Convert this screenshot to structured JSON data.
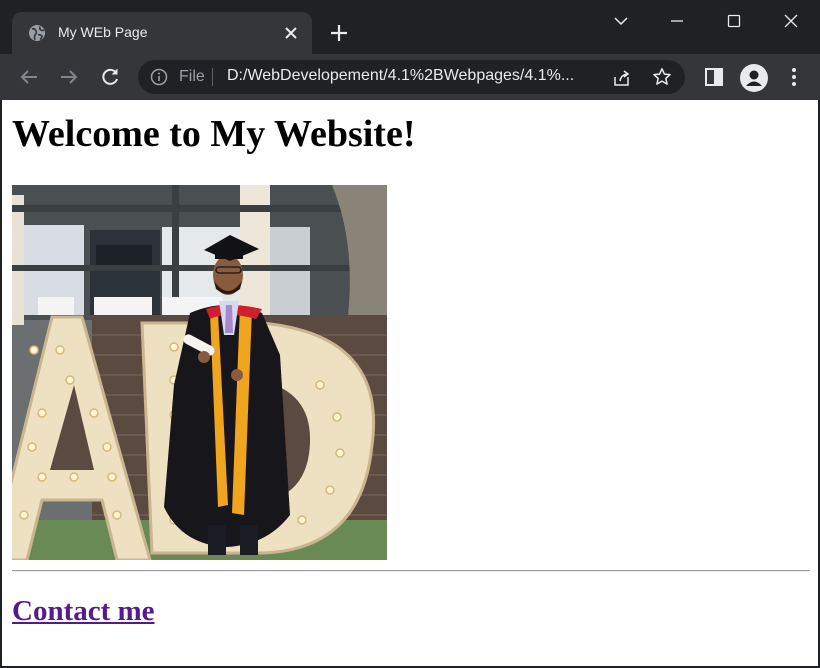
{
  "browser": {
    "tab": {
      "title": "My WEb Page",
      "favicon": "globe-icon"
    },
    "omnibox": {
      "scheme_label": "File",
      "url": "D:/WebDevelopement/4.1%2BWebpages/4.1%..."
    },
    "icons": {
      "new_tab": "plus-icon",
      "tab_search": "chevron-down-icon",
      "minimize": "minimize-icon",
      "maximize": "maximize-icon",
      "close": "close-icon",
      "back": "arrow-left-icon",
      "forward": "arrow-right-icon",
      "reload": "reload-icon",
      "info": "info-icon",
      "share": "share-icon",
      "bookmark": "star-icon",
      "side_panel": "side-panel-icon",
      "profile": "person-icon",
      "menu": "kebab-menu-icon"
    },
    "colors": {
      "frame": "#202124",
      "toolbar": "#35363a",
      "text": "#e8eaed",
      "muted_text": "#9aa0a6"
    }
  },
  "page": {
    "heading": "Welcome to My Website!",
    "photo": "graduate-in-gown-photo",
    "link_text": "Contact me",
    "link_color": "#551a8b"
  }
}
